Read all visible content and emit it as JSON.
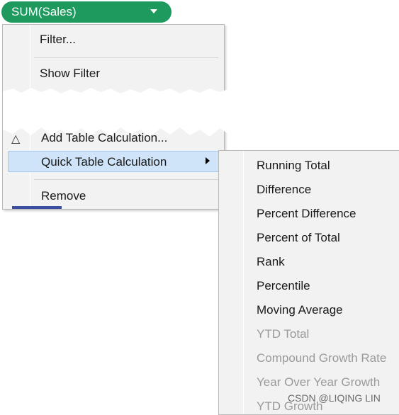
{
  "pill": {
    "label": "SUM(Sales)",
    "icon": "chevron-down-icon"
  },
  "menu": {
    "items": [
      {
        "label": "Filter..."
      },
      {
        "label": "Show Filter"
      },
      {
        "label": "Add Table Calculation...",
        "icon": "delta-icon"
      },
      {
        "label": "Quick Table Calculation",
        "icon": "submenu-arrow-icon"
      },
      {
        "label": "Remove"
      }
    ]
  },
  "submenu": {
    "items": [
      {
        "label": "Running Total"
      },
      {
        "label": "Difference"
      },
      {
        "label": "Percent Difference"
      },
      {
        "label": "Percent of Total"
      },
      {
        "label": "Rank"
      },
      {
        "label": "Percentile"
      },
      {
        "label": "Moving Average"
      },
      {
        "label": "YTD Total"
      },
      {
        "label": "Compound Growth Rate"
      },
      {
        "label": "Year Over Year Growth"
      },
      {
        "label": "YTD Growth"
      }
    ]
  },
  "watermark": "CSDN @LIQING LIN",
  "colors": {
    "pill": "#1f9a5e",
    "highlight": "#cfe4f8",
    "disabled_text": "#9a9a9a"
  }
}
